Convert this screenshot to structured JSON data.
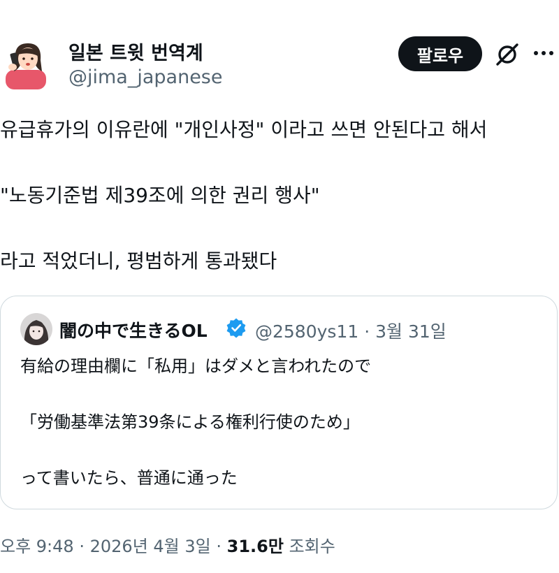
{
  "author": {
    "display_name": "일본 트윗 번역계",
    "handle": "@jima_japanese",
    "avatar_icon": "woman-on-phone-avatar"
  },
  "actions": {
    "follow_label": "팔로우",
    "grok_icon": "slashed-circle-icon",
    "more_icon": "more-dots-icon"
  },
  "tweet": {
    "lines": [
      "유급휴가의 이유란에 \"개인사정\" 이라고 쓰면 안된다고 해서",
      "\"노동기준법 제39조에 의한 권리 행사\"",
      "라고 적었더니, 평범하게 통과됐다"
    ]
  },
  "quoted": {
    "display_name": "闇の中で生きるOL",
    "verified_icon": "verified-badge-icon",
    "handle": "@2580ys11",
    "separator": "·",
    "date": "3월 31일",
    "lines": [
      "有給の理由欄に「私用」はダメと言われたので",
      "「労働基準法第39条による権利行使のため」",
      "って書いたら、普通に通った"
    ]
  },
  "footer": {
    "time": "오후 9:48",
    "separator": "·",
    "date": "2026년 4월 3일",
    "views_count": "31.6만",
    "views_label": "조회수"
  },
  "colors": {
    "text": "#0f1419",
    "secondary": "#536471",
    "verified": "#1d9bf0",
    "border": "#cfd9de",
    "follow_bg": "#0f1419"
  }
}
